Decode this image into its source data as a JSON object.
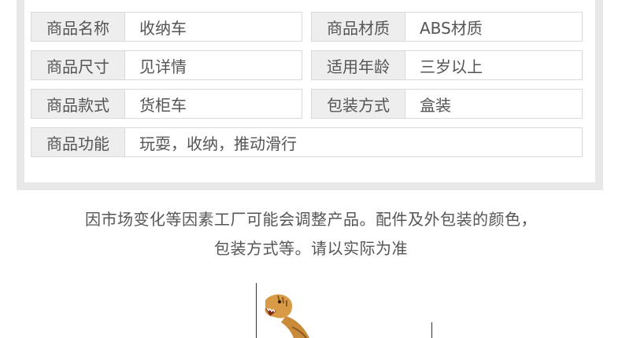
{
  "specs": [
    {
      "label": "商品名称",
      "value": "收纳车"
    },
    {
      "label": "商品材质",
      "value": "ABS材质"
    },
    {
      "label": "商品尺寸",
      "value": "见详情"
    },
    {
      "label": "适用年龄",
      "value": "三岁以上"
    },
    {
      "label": "商品款式",
      "value": "货柜车"
    },
    {
      "label": "包装方式",
      "value": "盒装"
    },
    {
      "label": "商品功能",
      "value": "玩耍，收纳，推动滑行"
    }
  ],
  "notice": {
    "line1": "因市场变化等因素工厂可能会调整产品。配件及外包装的颜色，",
    "line2": "包装方式等。请以实际为准"
  },
  "colors": {
    "panel_bg": "#e8e8e8",
    "label_bg": "#eeeeee",
    "border": "#d9d9d9",
    "text": "#555555"
  }
}
